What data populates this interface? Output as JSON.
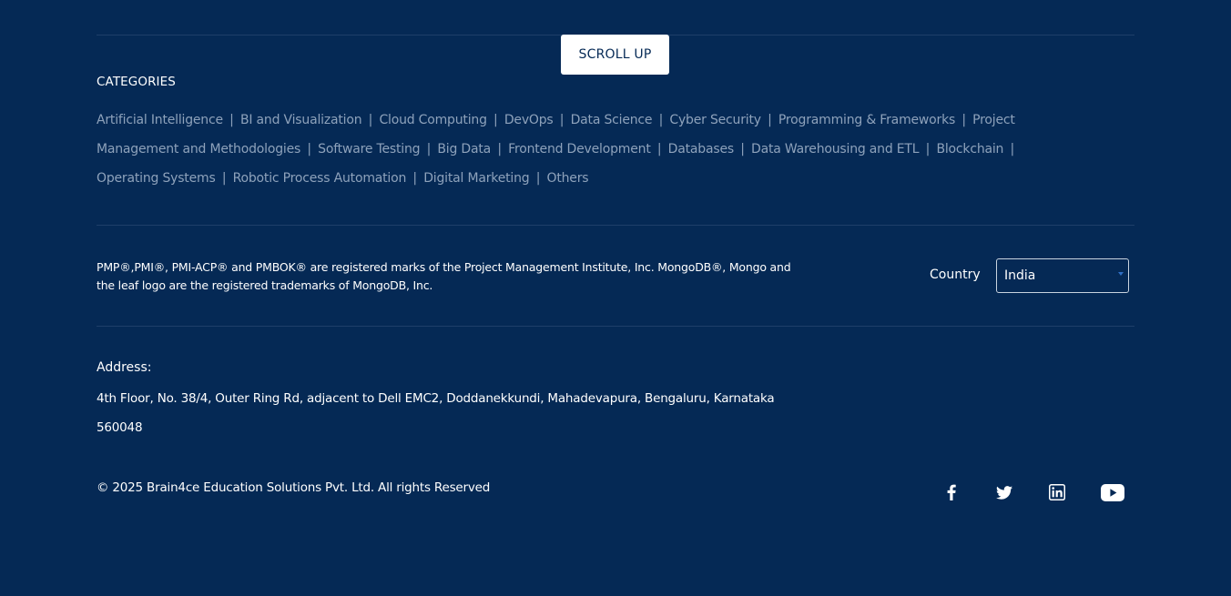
{
  "scroll_up": {
    "label": "SCROLL UP"
  },
  "categories": {
    "heading": "CATEGORIES",
    "items": [
      "Artificial Intelligence",
      "BI and Visualization",
      "Cloud Computing",
      "DevOps",
      "Data Science",
      "Cyber Security",
      "Programming & Frameworks",
      "Project Management and Methodologies",
      "Software Testing",
      "Big Data",
      "Frontend Development",
      "Databases",
      "Data Warehousing and ETL",
      "Blockchain",
      "Operating Systems",
      "Robotic Process Automation",
      "Digital Marketing",
      "Others"
    ],
    "separator": "|"
  },
  "disclaimer": {
    "text": "PMP®,PMI®, PMI-ACP® and PMBOK® are registered marks of the Project Management Institute, Inc. MongoDB®, Mongo and the leaf logo are the registered trademarks of MongoDB, Inc."
  },
  "country": {
    "label": "Country",
    "selected": "India"
  },
  "address": {
    "label": "Address:",
    "text": "4th Floor, No. 38/4, Outer Ring Rd, adjacent to Dell EMC2, Doddanekkundi, Mahadevapura, Bengaluru, Karnataka 560048"
  },
  "footer": {
    "copyright": "© 2025 Brain4ce Education Solutions Pvt. Ltd. All rights Reserved"
  },
  "social": [
    {
      "icon": "facebook-icon"
    },
    {
      "icon": "twitter-icon"
    },
    {
      "icon": "linkedin-icon"
    },
    {
      "icon": "youtube-icon"
    }
  ],
  "colors": {
    "background": "#052955",
    "muted_text": "#8ea2bb",
    "divider": "#1f3f69"
  }
}
